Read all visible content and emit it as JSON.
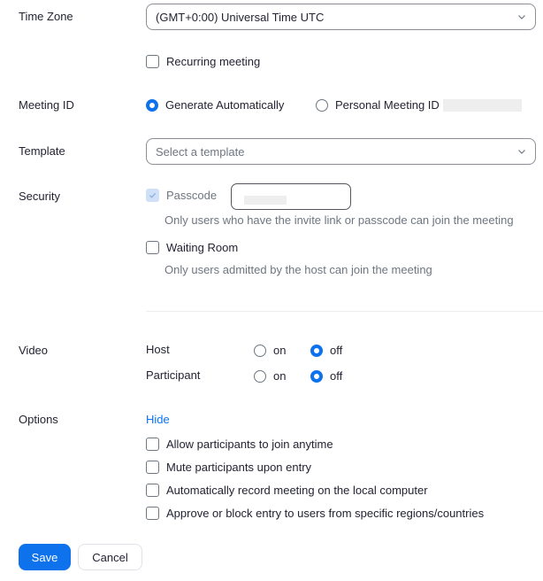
{
  "time_zone": {
    "label": "Time Zone",
    "value": "(GMT+0:00) Universal Time UTC"
  },
  "recurring": {
    "label": "Recurring meeting",
    "checked": false
  },
  "meeting_id": {
    "label": "Meeting ID",
    "options": [
      {
        "label": "Generate Automatically",
        "selected": true
      },
      {
        "label": "Personal Meeting ID",
        "selected": false
      }
    ]
  },
  "template": {
    "label": "Template",
    "placeholder": "Select a template"
  },
  "security": {
    "label": "Security",
    "passcode": {
      "label": "Passcode",
      "checked": true,
      "disabled": true,
      "hint": "Only users who have the invite link or passcode can join the meeting"
    },
    "waiting_room": {
      "label": "Waiting Room",
      "checked": false,
      "hint": "Only users admitted by the host can join the meeting"
    }
  },
  "video": {
    "label": "Video",
    "rows": [
      {
        "label": "Host",
        "on_label": "on",
        "off_label": "off",
        "value": "off"
      },
      {
        "label": "Participant",
        "on_label": "on",
        "off_label": "off",
        "value": "off"
      }
    ]
  },
  "options": {
    "label": "Options",
    "toggle_link": "Hide",
    "items": [
      {
        "label": "Allow participants to join anytime",
        "checked": false
      },
      {
        "label": "Mute participants upon entry",
        "checked": false
      },
      {
        "label": "Automatically record meeting on the local computer",
        "checked": false
      },
      {
        "label": "Approve or block entry to users from specific regions/countries",
        "checked": false
      }
    ]
  },
  "actions": {
    "save": "Save",
    "cancel": "Cancel"
  },
  "colors": {
    "accent": "#0e72ed",
    "text": "#232333",
    "muted": "#6e7680"
  }
}
